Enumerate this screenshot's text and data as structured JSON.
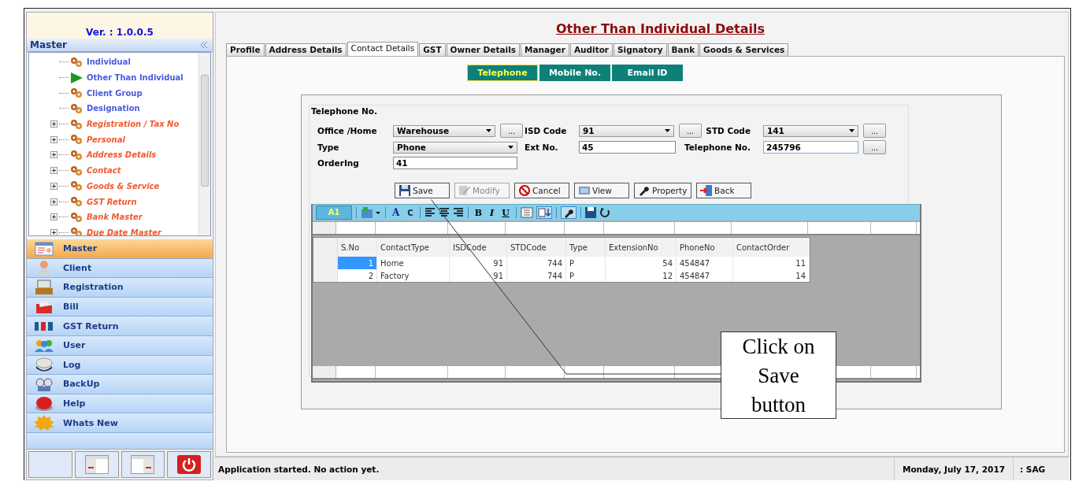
{
  "sidebar": {
    "version": "Ver. : 1.0.0.5",
    "header": "Master",
    "tree": [
      {
        "label": "Individual",
        "kind": "leaf",
        "selected": false
      },
      {
        "label": "Other Than Individual",
        "kind": "leaf",
        "selected": true
      },
      {
        "label": "Client Group",
        "kind": "leaf",
        "selected": false
      },
      {
        "label": "Designation",
        "kind": "leaf",
        "selected": false
      },
      {
        "label": "Registration / Tax No",
        "kind": "group",
        "expanded": false,
        "selected": false
      },
      {
        "label": "Personal",
        "kind": "group",
        "expanded": false,
        "selected": false
      },
      {
        "label": "Address Details",
        "kind": "group",
        "expanded": false,
        "selected": false
      },
      {
        "label": "Contact",
        "kind": "group",
        "expanded": false,
        "selected": false
      },
      {
        "label": "Goods & Service",
        "kind": "group",
        "expanded": false,
        "selected": false
      },
      {
        "label": "GST Return",
        "kind": "group",
        "expanded": false,
        "selected": false
      },
      {
        "label": "Bank Master",
        "kind": "group",
        "expanded": false,
        "selected": false
      },
      {
        "label": "Due Date Master",
        "kind": "group",
        "expanded": false,
        "selected": false
      }
    ],
    "nav": [
      {
        "label": "Master",
        "selected": true
      },
      {
        "label": "Client",
        "selected": false
      },
      {
        "label": "Registration",
        "selected": false
      },
      {
        "label": "Bill",
        "selected": false
      },
      {
        "label": "GST Return",
        "selected": false
      },
      {
        "label": "User",
        "selected": false
      },
      {
        "label": "Log",
        "selected": false
      },
      {
        "label": "BackUp",
        "selected": false
      },
      {
        "label": "Help",
        "selected": false
      },
      {
        "label": "Whats New",
        "selected": false
      }
    ]
  },
  "title": "Other Than Individual Details",
  "tabs": [
    {
      "label": "Profile",
      "selected": false
    },
    {
      "label": "Address Details",
      "selected": false
    },
    {
      "label": "Contact Details",
      "selected": true
    },
    {
      "label": "GST",
      "selected": false
    },
    {
      "label": "Owner Details",
      "selected": false
    },
    {
      "label": "Manager",
      "selected": false
    },
    {
      "label": "Auditor",
      "selected": false
    },
    {
      "label": "Signatory",
      "selected": false
    },
    {
      "label": "Bank",
      "selected": false
    },
    {
      "label": "Goods & Services",
      "selected": false
    }
  ],
  "subtabs": [
    {
      "label": "Telephone",
      "selected": true
    },
    {
      "label": "Mobile No.",
      "selected": false
    },
    {
      "label": "Email ID",
      "selected": false
    }
  ],
  "group_title": "Telephone No.",
  "fields": [
    {
      "label": "Office /Home",
      "kind": "dropdown",
      "value": "Warehouse",
      "more": "..."
    },
    {
      "label": "ISD Code",
      "kind": "dropdown",
      "value": "91",
      "more": "..."
    },
    {
      "label": "STD Code",
      "kind": "dropdown",
      "value": "141",
      "more": "..."
    },
    {
      "label": "Type",
      "kind": "dropdown",
      "value": "Phone"
    },
    {
      "label": "Ext No.",
      "kind": "text",
      "value": "45"
    },
    {
      "label": "Telephone No.",
      "kind": "text",
      "value": "245796",
      "more": "..."
    },
    {
      "label": "OrderIng",
      "kind": "text",
      "value": "41"
    }
  ],
  "buttons": [
    {
      "label": "Save",
      "disabled": false
    },
    {
      "label": "Modify",
      "disabled": true
    },
    {
      "label": "Cancel",
      "disabled": false
    },
    {
      "label": "View",
      "disabled": false
    },
    {
      "label": "Property",
      "disabled": false
    },
    {
      "label": "Back",
      "disabled": false
    }
  ],
  "grid_toolbar": {
    "cell_ref": "A1",
    "font_buttons": [
      "A",
      "C"
    ],
    "style_buttons": [
      "B",
      "I",
      "U"
    ]
  },
  "table": {
    "columns": [
      "S.No",
      "ContactType",
      "ISDCode",
      "STDCode",
      "Type",
      "ExtensionNo",
      "PhoneNo",
      "ContactOrder"
    ],
    "rows": [
      {
        "cells": [
          "1",
          "Home",
          "91",
          "744",
          "P",
          "54",
          "454847",
          "11"
        ],
        "selected": true
      },
      {
        "cells": [
          "2",
          "Factory",
          "91",
          "744",
          "P",
          "12",
          "454847",
          "14"
        ],
        "selected": false
      }
    ]
  },
  "callout": [
    "Click on",
    "Save",
    "button"
  ],
  "status_bar": {
    "message": "Application started. No action yet.",
    "date": "Monday, July 17, 2017",
    "user": ": SAG"
  }
}
